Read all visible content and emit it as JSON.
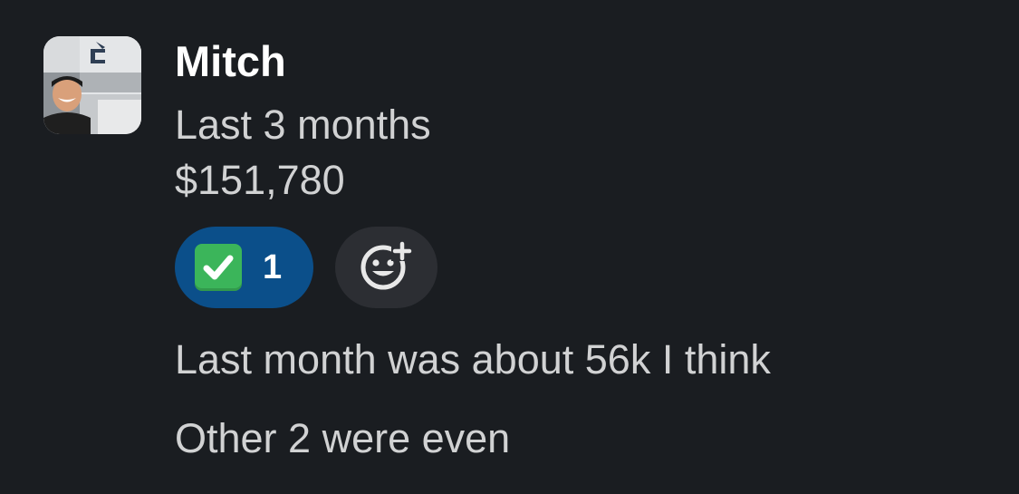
{
  "message": {
    "author": "Mitch",
    "lines": [
      "Last 3 months",
      "$151,780"
    ],
    "followups": [
      "Last month was about 56k I think",
      "Other 2 were even"
    ]
  },
  "reactions": [
    {
      "emoji": "white-check-mark-icon",
      "count": "1",
      "selected": true,
      "color": "#0b4f8a"
    }
  ],
  "add_reaction": {
    "icon": "add-emoji-icon"
  },
  "colors": {
    "background": "#1a1d21",
    "text": "#d1d2d3",
    "author": "#ffffff",
    "reaction_selected": "#0b4f8a",
    "add_reaction_bg": "#2c2e33"
  }
}
